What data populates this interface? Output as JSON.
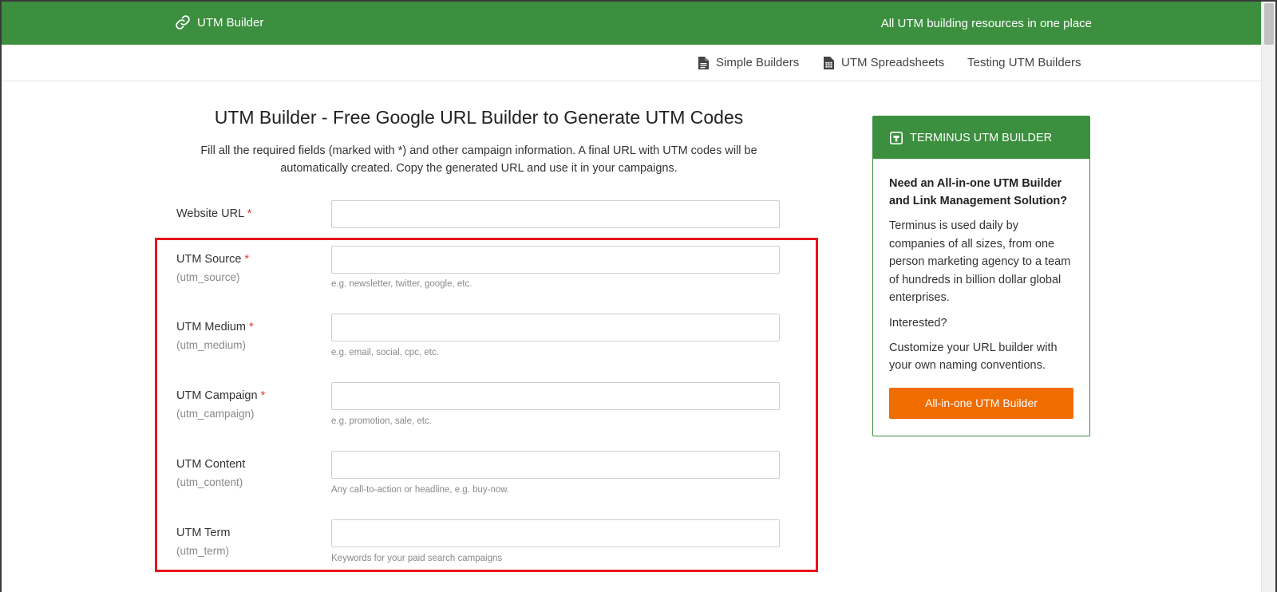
{
  "header": {
    "brand": "UTM Builder",
    "tagline": "All UTM building resources in one place"
  },
  "nav": {
    "items": [
      {
        "label": "Simple Builders",
        "icon": "document-icon"
      },
      {
        "label": "UTM Spreadsheets",
        "icon": "spreadsheet-icon"
      },
      {
        "label": "Testing UTM Builders",
        "icon": ""
      }
    ]
  },
  "main": {
    "title": "UTM Builder - Free Google URL Builder to Generate UTM Codes",
    "intro": "Fill all the required fields (marked with *) and other campaign information. A final URL with UTM codes will be automatically created. Copy the generated URL and use it in your campaigns.",
    "fields": [
      {
        "label": "Website URL",
        "required": "*",
        "sub": "",
        "value": "",
        "hint": ""
      },
      {
        "label": "UTM Source",
        "required": "*",
        "sub": "(utm_source)",
        "value": "",
        "hint": "e.g. newsletter, twitter, google, etc."
      },
      {
        "label": "UTM Medium",
        "required": "*",
        "sub": "(utm_medium)",
        "value": "",
        "hint": "e.g. email, social, cpc, etc."
      },
      {
        "label": "UTM Campaign",
        "required": "*",
        "sub": "(utm_campaign)",
        "value": "",
        "hint": "e.g. promotion, sale, etc."
      },
      {
        "label": "UTM Content",
        "required": "",
        "sub": "(utm_content)",
        "value": "",
        "hint": "Any call-to-action or headline, e.g. buy-now."
      },
      {
        "label": "UTM Term",
        "required": "",
        "sub": "(utm_term)",
        "value": "",
        "hint": "Keywords for your paid search campaigns"
      }
    ]
  },
  "sidebar": {
    "header": "TERMINUS UTM BUILDER",
    "heading": "Need an All-in-one UTM Builder and Link Management Solution?",
    "text": "Terminus is used daily by companies of all sizes, from one person marketing agency to a team of hundreds in billion dollar global enterprises.",
    "interested": "Interested?",
    "custom": "Customize your URL builder with your own naming conventions.",
    "button": "All-in-one UTM Builder"
  },
  "colors": {
    "brand_green": "#3b8f3e",
    "button_orange": "#ef6c00",
    "required_red": "#e53935",
    "highlight_red": "#e8141c"
  }
}
